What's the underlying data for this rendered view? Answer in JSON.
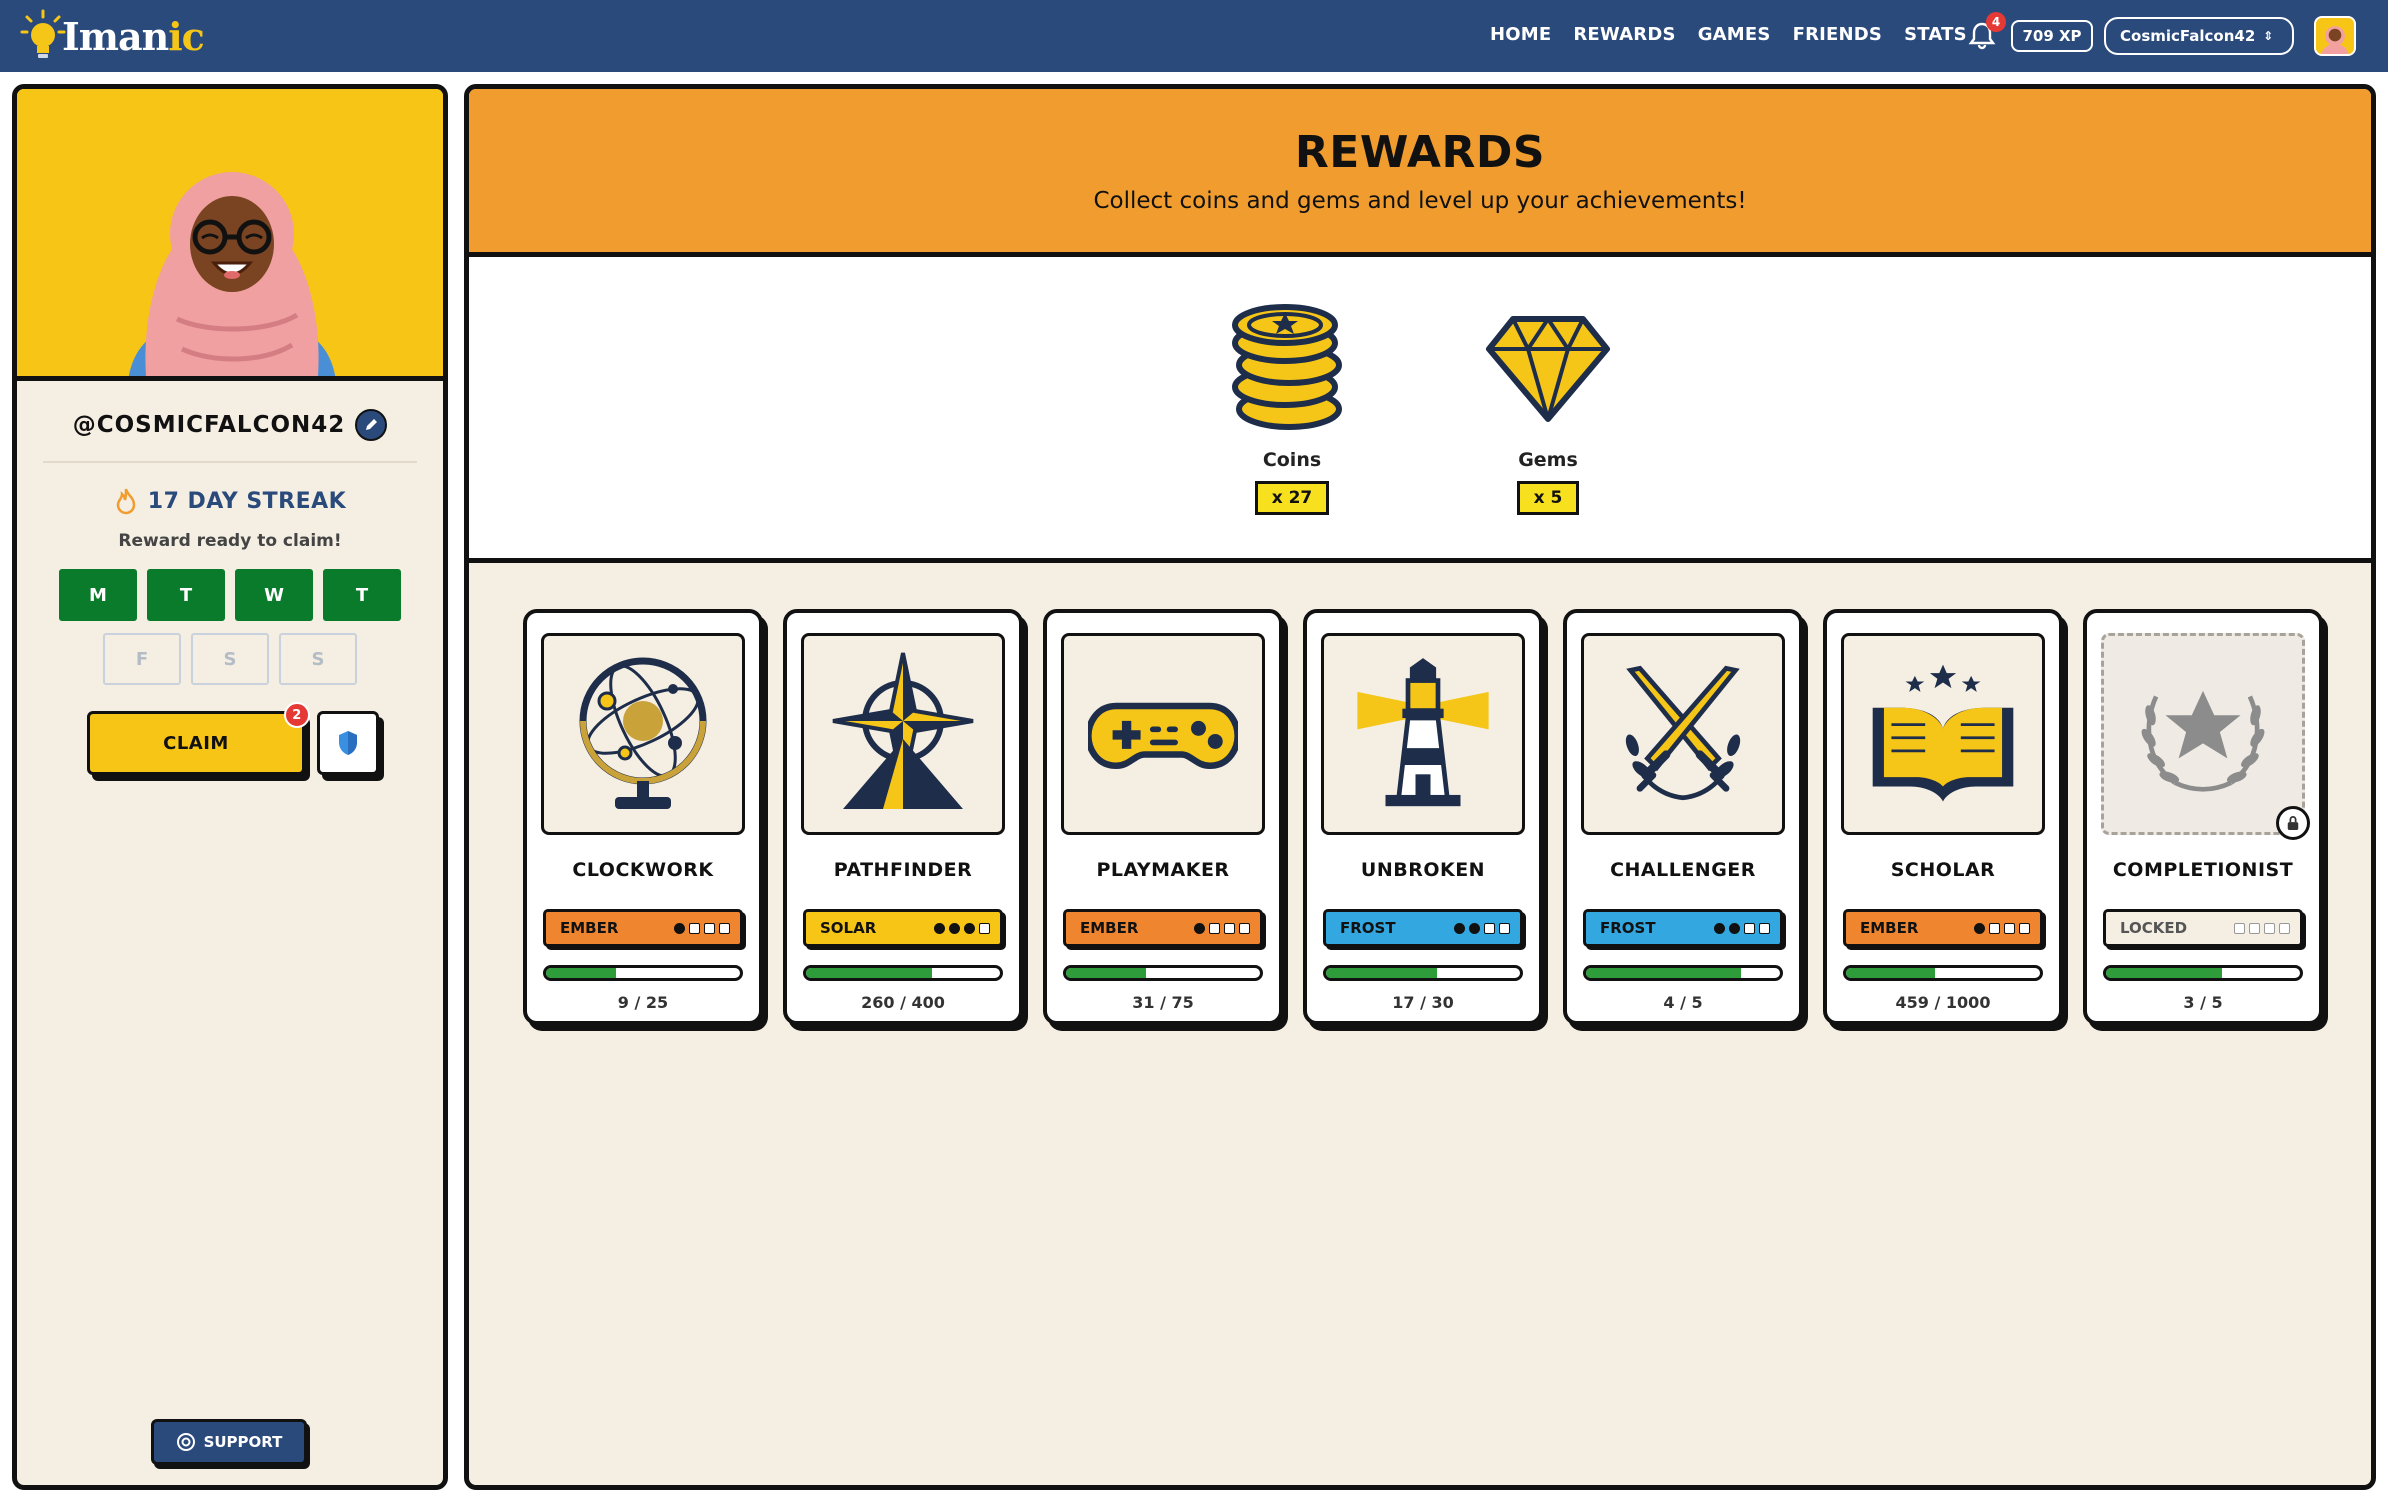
{
  "app": {
    "logo_text": "Imanic",
    "logo_text_main": "Iman",
    "logo_text_accent": "ic"
  },
  "nav": {
    "items": [
      "HOME",
      "REWARDS",
      "GAMES",
      "FRIENDS",
      "STATS"
    ],
    "notifications_count": "4",
    "xp": "709 XP",
    "username": "CosmicFalcon42"
  },
  "profile": {
    "handle": "@COSMICFALCON42",
    "streak": "17 DAY STREAK",
    "reward_status": "Reward ready to claim!",
    "days": [
      {
        "label": "M",
        "done": true
      },
      {
        "label": "T",
        "done": true
      },
      {
        "label": "W",
        "done": true
      },
      {
        "label": "T",
        "done": true
      },
      {
        "label": "F",
        "done": false
      },
      {
        "label": "S",
        "done": false
      },
      {
        "label": "S",
        "done": false
      }
    ],
    "claim_label": "CLAIM",
    "claim_badge": "2",
    "support_label": "SUPPORT"
  },
  "rewards": {
    "title": "REWARDS",
    "subtitle": "Collect coins and gems and level up your achievements!",
    "currencies": [
      {
        "label": "Coins",
        "count": "x 27",
        "icon": "coins-icon"
      },
      {
        "label": "Gems",
        "count": "x 5",
        "icon": "gem-icon"
      }
    ]
  },
  "achievements": [
    {
      "name": "CLOCKWORK",
      "icon": "armillary-sphere-icon",
      "tier": "EMBER",
      "tier_class": "ember",
      "dots": 1,
      "progress": 0.36,
      "progress_text": "9 / 25",
      "locked": false
    },
    {
      "name": "PATHFINDER",
      "icon": "compass-rose-icon",
      "tier": "SOLAR",
      "tier_class": "solar",
      "dots": 3,
      "progress": 0.65,
      "progress_text": "260 / 400",
      "locked": false
    },
    {
      "name": "PLAYMAKER",
      "icon": "gamepad-icon",
      "tier": "EMBER",
      "tier_class": "ember",
      "dots": 1,
      "progress": 0.41,
      "progress_text": "31 / 75",
      "locked": false
    },
    {
      "name": "UNBROKEN",
      "icon": "lighthouse-icon",
      "tier": "FROST",
      "tier_class": "frost",
      "dots": 2,
      "progress": 0.57,
      "progress_text": "17 / 30",
      "locked": false
    },
    {
      "name": "CHALLENGER",
      "icon": "crossed-swords-icon",
      "tier": "FROST",
      "tier_class": "frost",
      "dots": 2,
      "progress": 0.8,
      "progress_text": "4 / 5",
      "locked": false
    },
    {
      "name": "SCHOLAR",
      "icon": "open-book-icon",
      "tier": "EMBER",
      "tier_class": "ember",
      "dots": 1,
      "progress": 0.46,
      "progress_text": "459 / 1000",
      "locked": false
    },
    {
      "name": "COMPLETIONIST",
      "icon": "laurel-star-icon",
      "tier": "LOCKED",
      "tier_class": "locked",
      "dots": 0,
      "progress": 0.6,
      "progress_text": "3 / 5",
      "locked": true
    }
  ],
  "colors": {
    "nav_bg": "#2b4a7c",
    "header_bg": "#f09c2e",
    "panel_bg": "#f5efe3",
    "streak_done": "#0a7a2b",
    "accent_yellow": "#f7c516",
    "progress_green": "#2e9c3a"
  }
}
